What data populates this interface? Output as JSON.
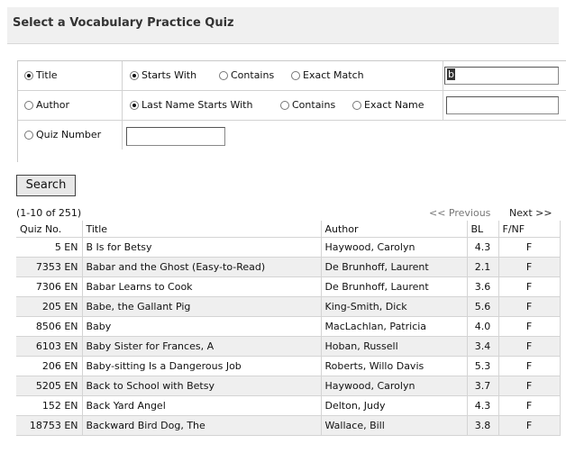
{
  "header": {
    "title": "Select a Vocabulary Practice Quiz"
  },
  "search": {
    "rows": [
      {
        "label": "Title",
        "checked": true,
        "options": [
          "Starts With",
          "Contains",
          "Exact Match"
        ],
        "selected_option": 0,
        "value": "b"
      },
      {
        "label": "Author",
        "checked": false,
        "options": [
          "Last Name Starts With",
          "Contains",
          "Exact Name"
        ],
        "selected_option": 0,
        "value": ""
      },
      {
        "label": "Quiz Number",
        "checked": false,
        "value": ""
      }
    ],
    "button_label": "Search"
  },
  "results": {
    "range_text": "(1-10 of 251)",
    "prev_label": "<< Previous",
    "next_label": "Next >>",
    "columns": [
      "Quiz No.",
      "Title",
      "Author",
      "BL",
      "F/NF"
    ],
    "rows": [
      {
        "quiz_no": "5 EN",
        "title": "B Is for Betsy",
        "author": "Haywood, Carolyn",
        "bl": "4.3",
        "fnf": "F"
      },
      {
        "quiz_no": "7353 EN",
        "title": "Babar and the Ghost (Easy-to-Read)",
        "author": "De Brunhoff, Laurent",
        "bl": "2.1",
        "fnf": "F"
      },
      {
        "quiz_no": "7306 EN",
        "title": "Babar Learns to Cook",
        "author": "De Brunhoff, Laurent",
        "bl": "3.6",
        "fnf": "F"
      },
      {
        "quiz_no": "205 EN",
        "title": "Babe, the Gallant Pig",
        "author": "King-Smith, Dick",
        "bl": "5.6",
        "fnf": "F"
      },
      {
        "quiz_no": "8506 EN",
        "title": "Baby",
        "author": "MacLachlan, Patricia",
        "bl": "4.0",
        "fnf": "F"
      },
      {
        "quiz_no": "6103 EN",
        "title": "Baby Sister for Frances, A",
        "author": "Hoban, Russell",
        "bl": "3.4",
        "fnf": "F"
      },
      {
        "quiz_no": "206 EN",
        "title": "Baby-sitting Is a Dangerous Job",
        "author": "Roberts, Willo Davis",
        "bl": "5.3",
        "fnf": "F"
      },
      {
        "quiz_no": "5205 EN",
        "title": "Back to School with Betsy",
        "author": "Haywood, Carolyn",
        "bl": "3.7",
        "fnf": "F"
      },
      {
        "quiz_no": "152 EN",
        "title": "Back Yard Angel",
        "author": "Delton, Judy",
        "bl": "4.3",
        "fnf": "F"
      },
      {
        "quiz_no": "18753 EN",
        "title": "Backward Bird Dog, The",
        "author": "Wallace, Bill",
        "bl": "3.8",
        "fnf": "F"
      }
    ]
  }
}
